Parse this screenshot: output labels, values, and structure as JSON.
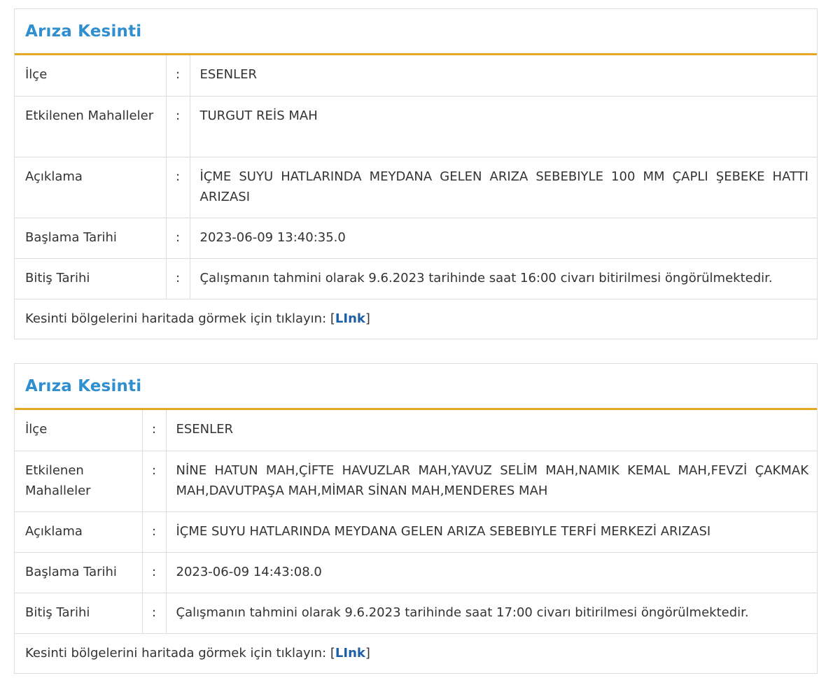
{
  "cards": [
    {
      "title": "Arıza Kesinti",
      "rows": [
        {
          "label": "İlçe",
          "sep": ":",
          "value": "ESENLER"
        },
        {
          "label": "Etkilenen Mahalleler",
          "sep": ":",
          "value": "TURGUT REİS MAH"
        },
        {
          "label": "Açıklama",
          "sep": ":",
          "value": "İÇME SUYU HATLARINDA MEYDANA GELEN ARIZA SEBEBIYLE 100 MM ÇAPLI ŞEBEKE HATTI ARIZASI"
        },
        {
          "label": "Başlama Tarihi",
          "sep": ":",
          "value": "2023-06-09 13:40:35.0"
        },
        {
          "label": "Bitiş Tarihi",
          "sep": ":",
          "value": "Çalışmanın tahmini olarak 9.6.2023 tarihinde saat 16:00 civarı bitirilmesi öngörülmektedir."
        }
      ],
      "footer": {
        "text": "Kesinti bölgelerini haritada görmek için tıklayın: ",
        "bracket_open": "[",
        "link_label": "LInk",
        "bracket_close": "]"
      }
    },
    {
      "title": "Arıza Kesinti",
      "rows": [
        {
          "label": "İlçe",
          "sep": ":",
          "value": "ESENLER"
        },
        {
          "label": "Etkilenen Mahalleler",
          "sep": ":",
          "value": "NİNE HATUN MAH,ÇİFTE HAVUZLAR MAH,YAVUZ SELİM MAH,NAMIK KEMAL MAH,FEVZİ ÇAKMAK MAH,DAVUTPAŞA MAH,MİMAR SİNAN MAH,MENDERES MAH"
        },
        {
          "label": "Açıklama",
          "sep": ":",
          "value": "İÇME SUYU HATLARINDA MEYDANA GELEN ARIZA SEBEBIYLE TERFİ MERKEZİ ARIZASI"
        },
        {
          "label": "Başlama Tarihi",
          "sep": ":",
          "value": "2023-06-09 14:43:08.0"
        },
        {
          "label": "Bitiş Tarihi",
          "sep": ":",
          "value": "Çalışmanın tahmini olarak 9.6.2023 tarihinde saat 17:00 civarı bitirilmesi öngörülmektedir."
        }
      ],
      "footer": {
        "text": "Kesinti bölgelerini haritada görmek için tıklayın: ",
        "bracket_open": "[",
        "link_label": "LInk",
        "bracket_close": "]"
      }
    }
  ],
  "colors": {
    "title": "#2f8fcf",
    "accent_border": "#e5a823",
    "link": "#1f5fa6",
    "text": "#333333",
    "border": "#dddddd"
  }
}
